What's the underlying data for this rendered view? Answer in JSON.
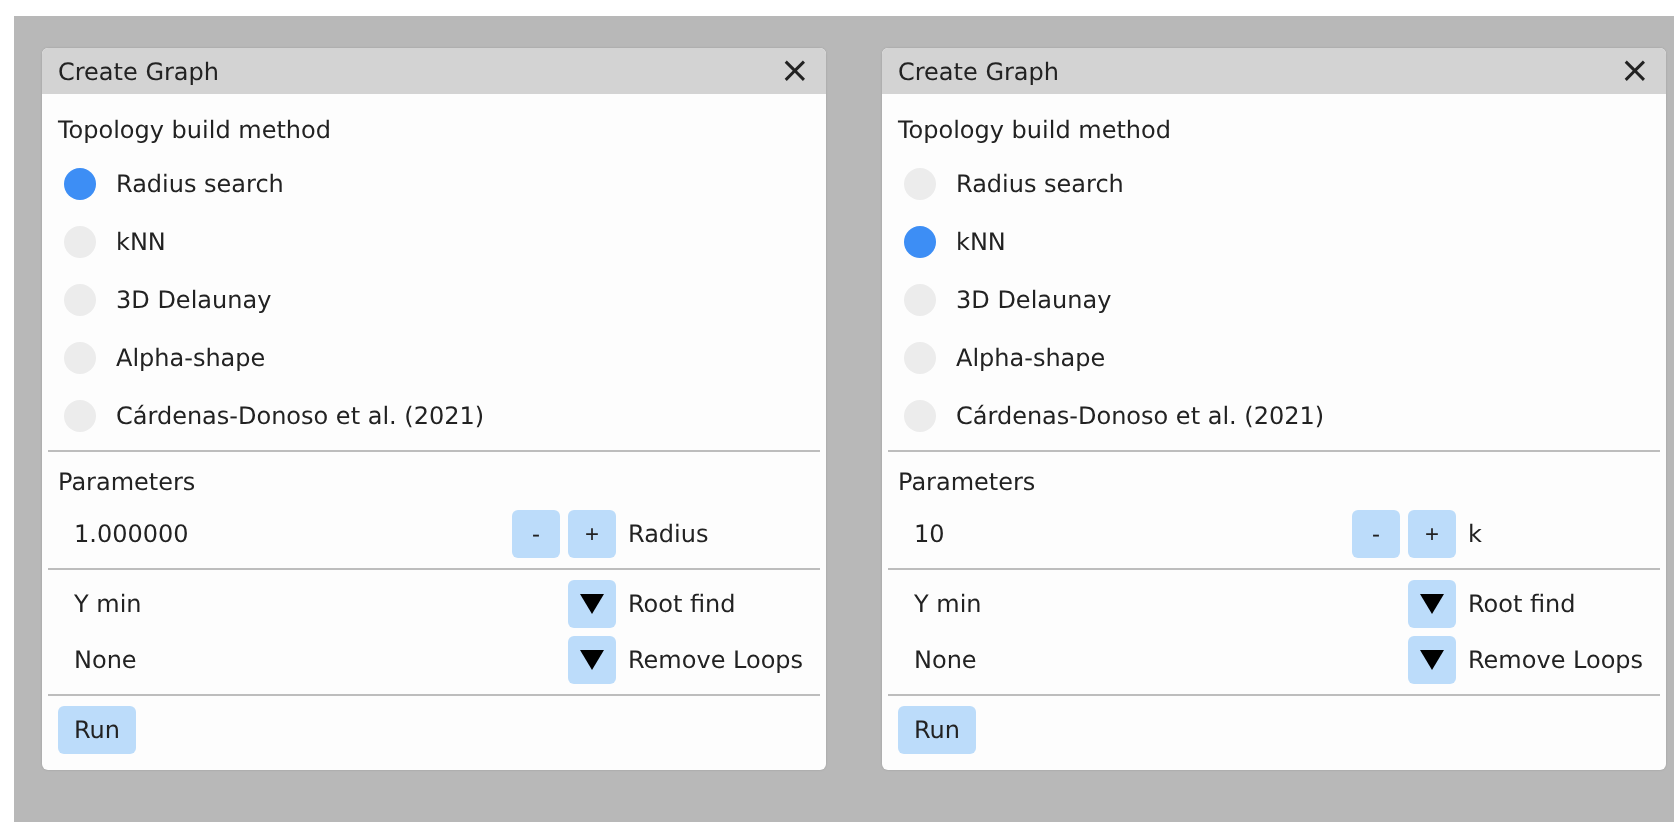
{
  "panels": [
    {
      "title": "Create Graph",
      "close": "×",
      "method_label": "Topology build method",
      "methods": [
        {
          "label": "Radius search",
          "selected": true
        },
        {
          "label": "kNN",
          "selected": false
        },
        {
          "label": "3D Delaunay",
          "selected": false
        },
        {
          "label": "Alpha-shape",
          "selected": false
        },
        {
          "label": "Cárdenas-Donoso et al. (2021)",
          "selected": false
        }
      ],
      "parameters_label": "Parameters",
      "param_value": "1.000000",
      "minus": "-",
      "plus": "+",
      "param_name": "Radius",
      "dropdowns": [
        {
          "value": "Y min",
          "label": "Root find"
        },
        {
          "value": "None",
          "label": "Remove Loops"
        }
      ],
      "run": "Run"
    },
    {
      "title": "Create Graph",
      "close": "×",
      "method_label": "Topology build method",
      "methods": [
        {
          "label": "Radius search",
          "selected": false
        },
        {
          "label": "kNN",
          "selected": true
        },
        {
          "label": "3D Delaunay",
          "selected": false
        },
        {
          "label": "Alpha-shape",
          "selected": false
        },
        {
          "label": "Cárdenas-Donoso et al. (2021)",
          "selected": false
        }
      ],
      "parameters_label": "Parameters",
      "param_value": "10",
      "minus": "-",
      "plus": "+",
      "param_name": "k",
      "dropdowns": [
        {
          "value": "Y min",
          "label": "Root find"
        },
        {
          "value": "None",
          "label": "Remove Loops"
        }
      ],
      "run": "Run"
    }
  ]
}
